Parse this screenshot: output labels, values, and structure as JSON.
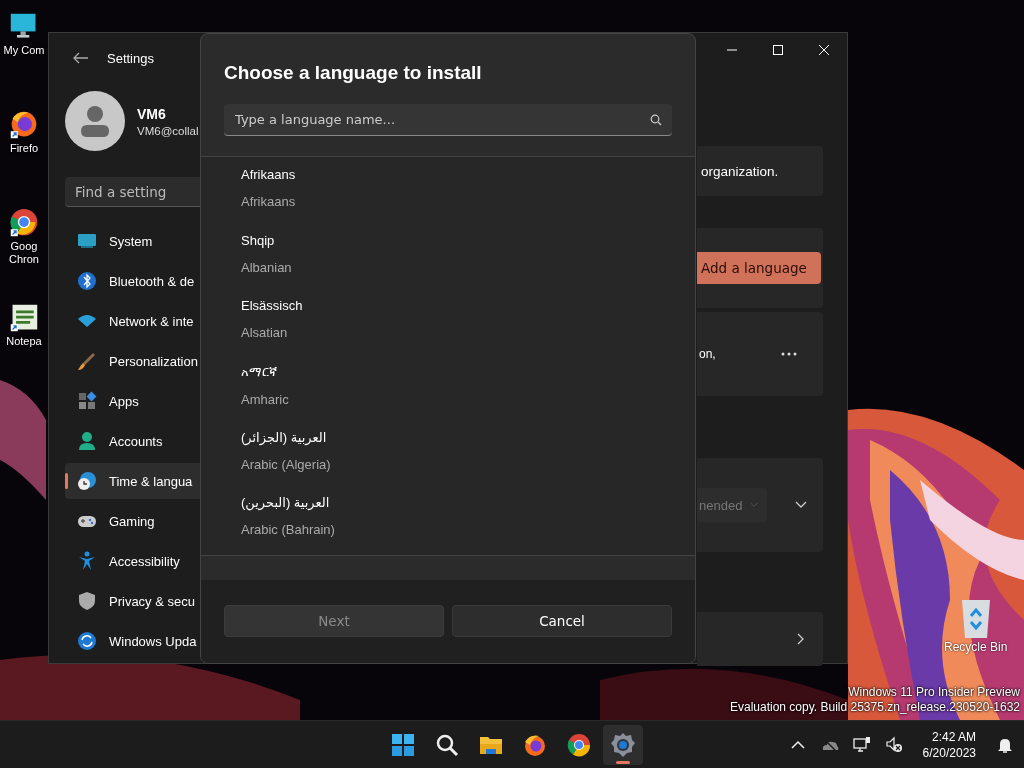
{
  "desktop": {
    "icons": [
      {
        "lines": [
          "My Com"
        ]
      },
      {
        "lines": [
          "Firefo"
        ]
      },
      {
        "lines": [
          "Goog",
          "Chron"
        ]
      },
      {
        "lines": [
          "Notepa"
        ]
      }
    ],
    "recycle_bin": {
      "label": "Recycle Bin"
    },
    "watermark": [
      "Windows 11 Pro Insider Preview",
      "Evaluation copy. Build 25375.zn_release.230520-1632"
    ]
  },
  "settings_window": {
    "title": "Settings",
    "user": {
      "name": "VM6",
      "email": "VM6@collal"
    },
    "search": {
      "placeholder": "Find a setting"
    },
    "nav": [
      {
        "label": "System",
        "selected": false
      },
      {
        "label": "Bluetooth & de",
        "selected": false
      },
      {
        "label": "Network & inte",
        "selected": false
      },
      {
        "label": "Personalization",
        "selected": false
      },
      {
        "label": "Apps",
        "selected": false
      },
      {
        "label": "Accounts",
        "selected": false
      },
      {
        "label": "Time & langua",
        "selected": true
      },
      {
        "label": "Gaming",
        "selected": false
      },
      {
        "label": "Accessibility",
        "selected": false
      },
      {
        "label": "Privacy & secu",
        "selected": false
      },
      {
        "label": "Windows Upda",
        "selected": false
      }
    ],
    "content": {
      "text_1": "organization.",
      "add_button": "Add a language",
      "text_2": "on,",
      "dropdown": "nended"
    }
  },
  "dialog": {
    "title": "Choose a language to install",
    "search": {
      "placeholder": "Type a language name..."
    },
    "languages": [
      {
        "name": "Afrikaans",
        "english": "Afrikaans"
      },
      {
        "name": "Shqip",
        "english": "Albanian"
      },
      {
        "name": "Elsässisch",
        "english": "Alsatian"
      },
      {
        "name": "አማርኛ",
        "english": "Amharic"
      },
      {
        "name": "العربية (الجزائر)",
        "english": "Arabic (Algeria)"
      },
      {
        "name": "العربية (البحرين)",
        "english": "Arabic (Bahrain)"
      }
    ],
    "buttons": [
      {
        "label": "Next",
        "disabled": true
      },
      {
        "label": "Cancel",
        "disabled": false
      }
    ]
  },
  "taskbar": {
    "apps": [
      {
        "active": false
      },
      {
        "active": false
      },
      {
        "active": false
      },
      {
        "active": false
      },
      {
        "active": false
      },
      {
        "active": true
      }
    ],
    "clock": {
      "time": "2:42 AM",
      "date": "6/20/2023"
    }
  }
}
